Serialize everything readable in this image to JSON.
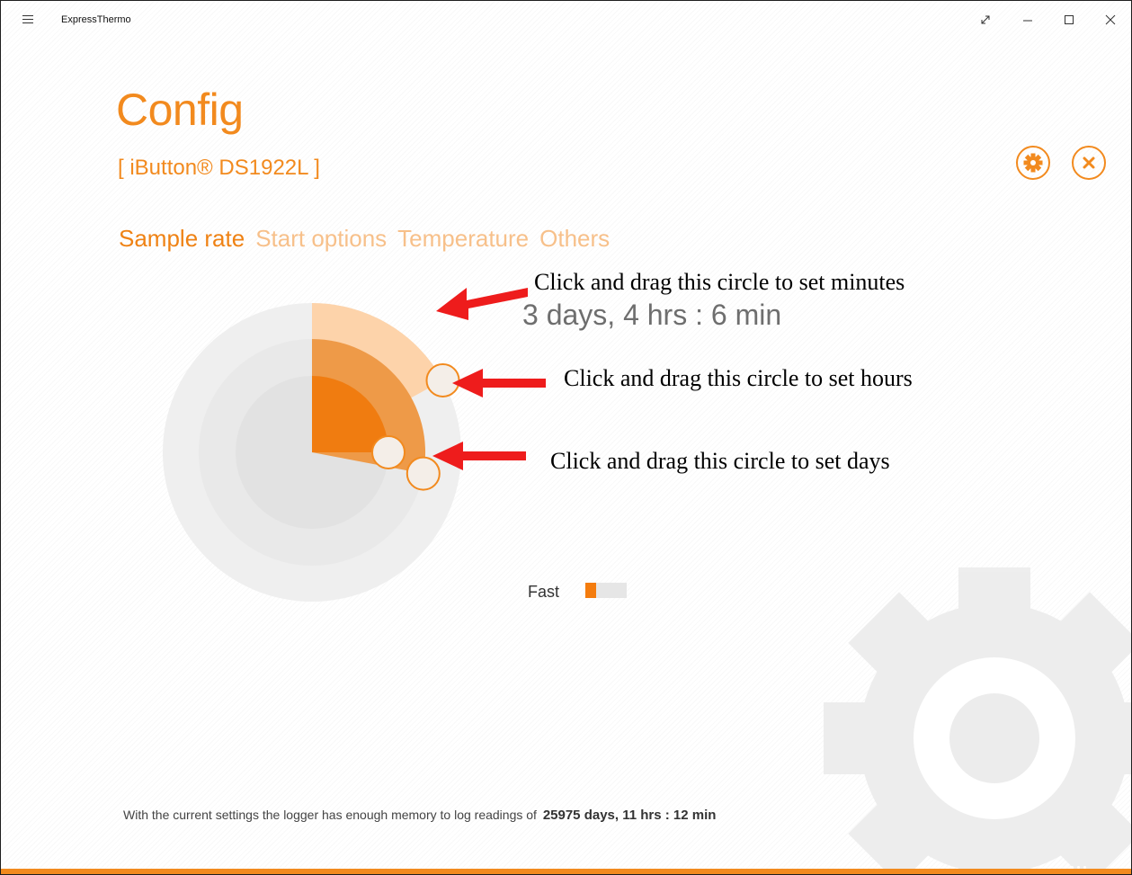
{
  "app": {
    "title": "ExpressThermo"
  },
  "header": {
    "title": "Config",
    "device": "[ iButton® DS1922L ]"
  },
  "tabs": [
    {
      "label": "Sample rate",
      "active": true
    },
    {
      "label": "Start options",
      "active": false
    },
    {
      "label": "Temperature",
      "active": false
    },
    {
      "label": "Others",
      "active": false
    }
  ],
  "sample_rate": {
    "duration": "3 days, 4 hrs : 6 min",
    "days": 3,
    "hours": 4,
    "minutes": 6,
    "speed_label": "Fast",
    "speed_level": 0.25
  },
  "annotations": {
    "minutes": "Click and drag this circle to set minutes",
    "hours": "Click and drag this circle to set hours",
    "days": "Click and drag this circle to set days"
  },
  "footer": {
    "memory_text": "With the current settings the logger has enough memory to log readings of",
    "memory_value": "25975 days, 11 hrs : 12 min"
  },
  "colors": {
    "accent": "#f28a1e",
    "tab_inactive": "#f7c08a",
    "days_arc": "#f07c10",
    "hours_arc": "#ee9a48",
    "minutes_arc": "#fdd3aa",
    "arrow": "#ee1c1c"
  },
  "icons": {
    "menu": "hamburger-icon",
    "expand": "expand-icon",
    "minimize": "minimize-icon",
    "maximize": "maximize-icon",
    "close": "close-icon",
    "settings": "gear-icon",
    "cancel": "close-circle-icon"
  }
}
